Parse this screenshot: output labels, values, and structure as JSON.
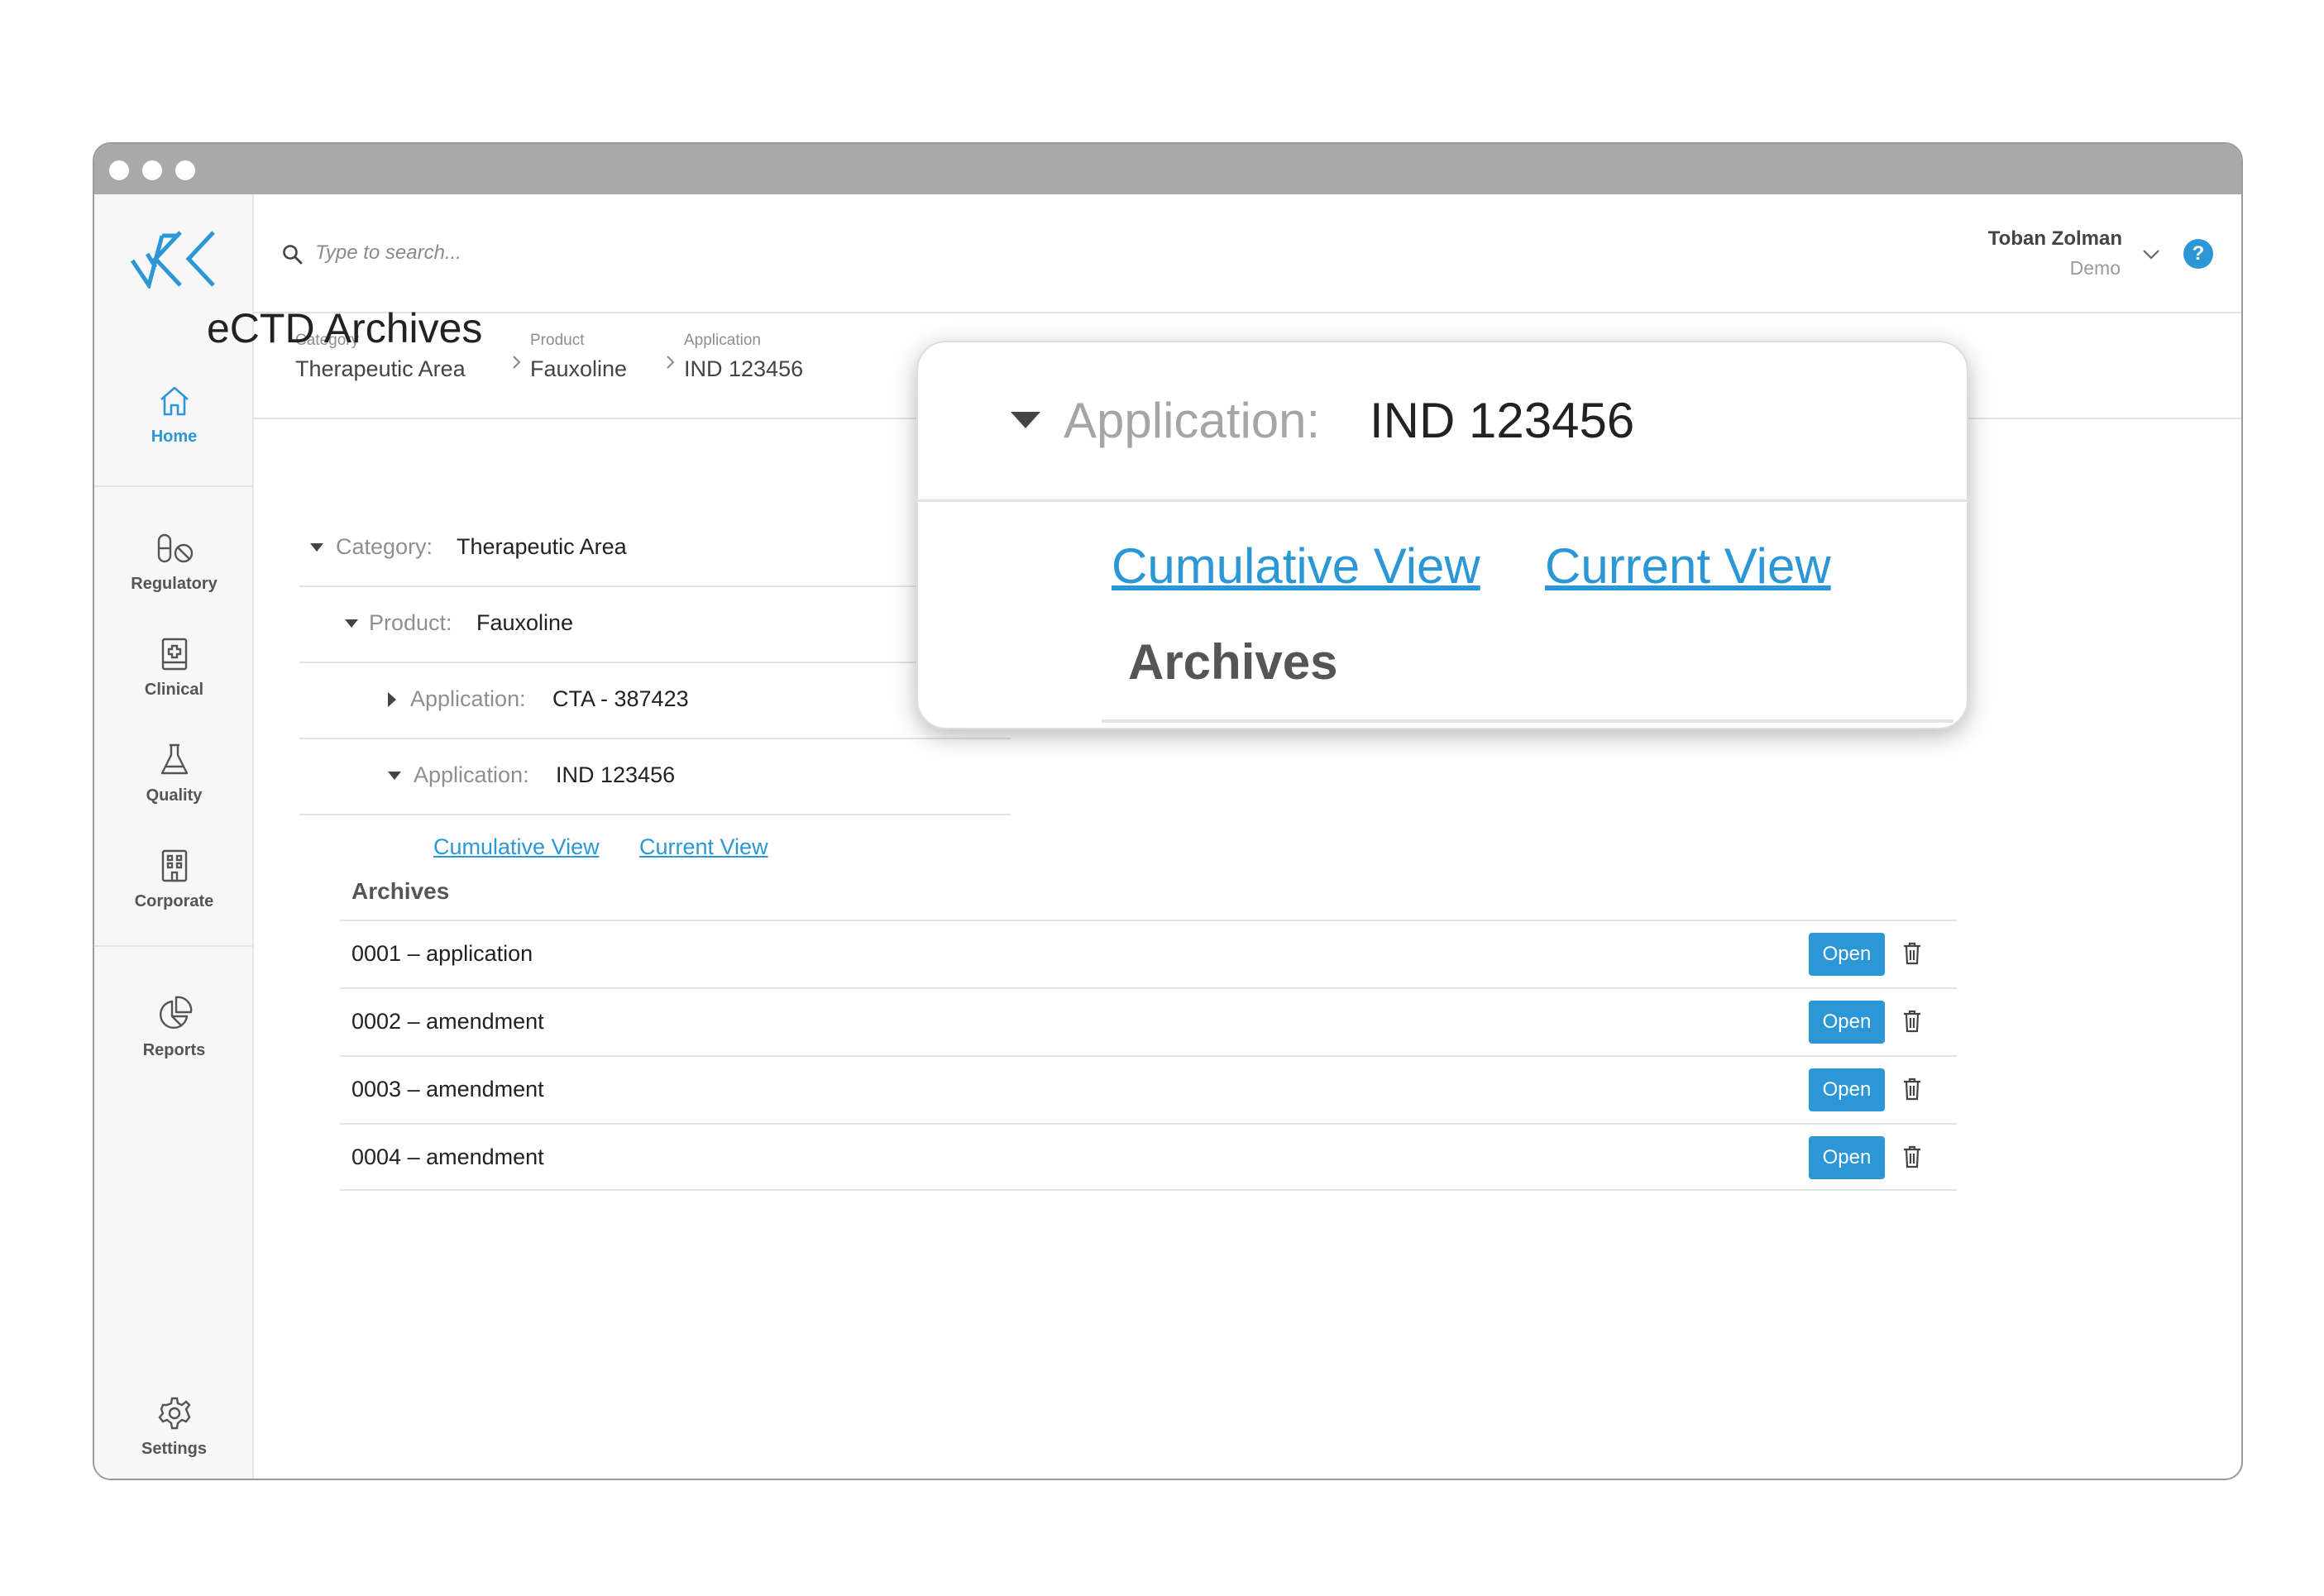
{
  "search": {
    "placeholder": "Type to search..."
  },
  "user": {
    "name": "Toban Zolman",
    "org": "Demo",
    "help": "?"
  },
  "sidebar": {
    "items": [
      {
        "label": "Home",
        "icon": "home-icon",
        "active": true
      },
      {
        "label": "Regulatory",
        "icon": "pills-icon"
      },
      {
        "label": "Clinical",
        "icon": "medical-book-icon"
      },
      {
        "label": "Quality",
        "icon": "flask-icon"
      },
      {
        "label": "Corporate",
        "icon": "building-icon"
      },
      {
        "label": "Reports",
        "icon": "pie-chart-icon"
      },
      {
        "label": "Settings",
        "icon": "gear-icon"
      }
    ]
  },
  "breadcrumb": [
    {
      "label": "Category",
      "value": "Therapeutic Area"
    },
    {
      "label": "Product",
      "value": "Fauxoline"
    },
    {
      "label": "Application",
      "value": "IND 123456"
    }
  ],
  "page": {
    "title": "eCTD Archives"
  },
  "tree": [
    {
      "label": "Category:",
      "value": "Therapeutic Area",
      "expanded": true
    },
    {
      "label": "Product:",
      "value": "Fauxoline",
      "expanded": true
    },
    {
      "label": "Application:",
      "value": "CTA - 387423",
      "expanded": false
    },
    {
      "label": "Application:",
      "value": "IND 123456",
      "expanded": true
    }
  ],
  "views": {
    "cumulative": "Cumulative View",
    "current": "Current View"
  },
  "archives": {
    "heading": "Archives",
    "open_label": "Open",
    "rows": [
      {
        "name": "0001 – application"
      },
      {
        "name": "0002 – amendment"
      },
      {
        "name": "0003 – amendment"
      },
      {
        "name": "0004 – amendment"
      }
    ]
  },
  "zoom": {
    "label": "Application:",
    "value": "IND 123456",
    "cumulative": "Cumulative View",
    "current": "Current View",
    "heading": "Archives"
  },
  "colors": {
    "accent": "#2b97d6",
    "titlebar": "#a9a9a9",
    "sidebar_bg": "#f7f7f7"
  }
}
